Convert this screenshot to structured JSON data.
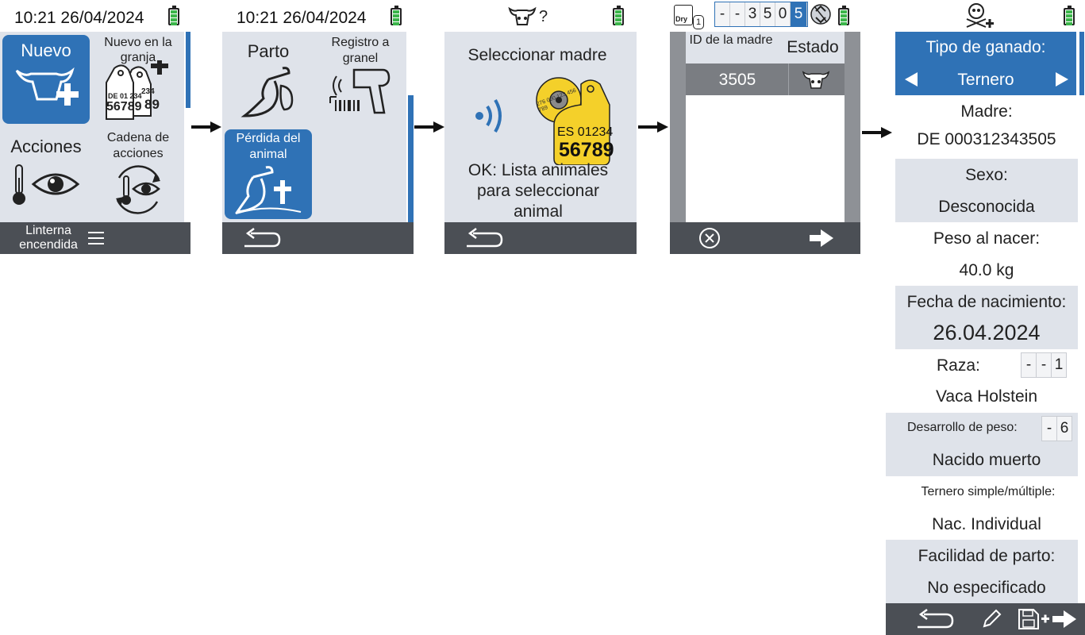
{
  "colors": {
    "accent": "#2f72b6",
    "panel": "#dfe3ea",
    "bar": "#4b4f55",
    "tag_yellow": "#f4d02a",
    "battery": "#3bb54a"
  },
  "screen1": {
    "time": "10:21 26/04/2024",
    "tile_nuevo": "Nuevo",
    "tile_nuevo_granja": "Nuevo en la granja",
    "tag_small_top": "DE 01 234",
    "tag_small_num": "56789",
    "tag_back_top": "234",
    "tag_back_num": "89",
    "tile_acciones": "Acciones",
    "tile_cadena": "Cadena de acciones",
    "bottom_label": "Linterna encendida"
  },
  "screen2": {
    "time": "10:21 26/04/2024",
    "tile_parto": "Parto",
    "tile_registro": "Registro a granel",
    "tile_perdida": "Pérdida del animal"
  },
  "screen3": {
    "header_unknown": "?",
    "title": "Seleccionar madre",
    "tag_round_text": "276 000 123 456 789",
    "tag_top": "ES 01234",
    "tag_num": "56789",
    "hint": "OK: Lista animales para seleccionar animal"
  },
  "screen4": {
    "dry_label": "Dry",
    "dry_count": "1",
    "id_digits": [
      "-",
      "-",
      "3",
      "5",
      "0",
      "5"
    ],
    "col_id": "ID de la madre",
    "col_estado": "Estado",
    "row_id": "3505"
  },
  "screen5": {
    "tipo_label": "Tipo de ganado:",
    "tipo_value": "Ternero",
    "madre_label": "Madre:",
    "madre_value": "DE 000312343505",
    "sexo_label": "Sexo:",
    "sexo_value": "Desconocida",
    "peso_label": "Peso al nacer:",
    "peso_value": "40.0 kg",
    "fecha_label": "Fecha de nacimiento:",
    "fecha_value": "26.04.2024",
    "raza_label": "Raza:",
    "raza_digits": [
      "-",
      "-",
      "1"
    ],
    "raza_value": "Vaca Holstein",
    "desarrollo_label": "Desarrollo de peso:",
    "desarrollo_digits": [
      "-",
      "6"
    ],
    "desarrollo_value": "Nacido muerto",
    "ternero_label": "Ternero simple/múltiple:",
    "ternero_value": "Nac. Individual",
    "facilidad_label": "Facilidad de parto:",
    "facilidad_value": "No especificado"
  }
}
